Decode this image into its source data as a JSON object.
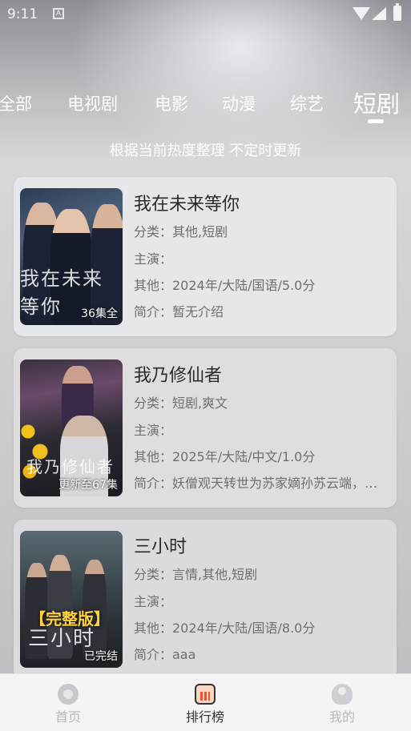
{
  "status": {
    "time": "9:11",
    "notification_icon": "A"
  },
  "tabs": [
    {
      "label": "全部"
    },
    {
      "label": "电视剧"
    },
    {
      "label": "电影"
    },
    {
      "label": "动漫"
    },
    {
      "label": "综艺"
    },
    {
      "label": "短剧",
      "active": true
    }
  ],
  "subtitle": "根据当前热度整理 不定时更新",
  "items": [
    {
      "title": "我在未来等你",
      "category": "分类：其他,短剧",
      "cast": "主演：",
      "other": "其他：2024年/大陆/国语/5.0分",
      "intro": "简介：暂无介绍",
      "badge": "36集全",
      "poster_text": "我在未来等你"
    },
    {
      "title": "我乃修仙者",
      "category": "分类：短剧,爽文",
      "cast": "主演：",
      "other": "其他：2025年/大陆/中文/1.0分",
      "intro": "简介：妖僧观天转世为苏家嫡孙苏云端，在苏家危难之际挺身而出",
      "badge": "更新至67集",
      "poster_text": "我乃修仙者"
    },
    {
      "title": "三小时",
      "category": "分类：言情,其他,短剧",
      "cast": "主演：",
      "other": "其他：2024年/大陆/国语/8.0分",
      "intro": "简介：aaa",
      "badge": "已完结",
      "poster_flag": "【完整版】",
      "poster_text": "三小时"
    }
  ],
  "bottom_nav": [
    {
      "label": "首页",
      "icon": "home-icon"
    },
    {
      "label": "排行榜",
      "icon": "ranking-icon",
      "active": true
    },
    {
      "label": "我的",
      "icon": "profile-icon"
    }
  ],
  "colors": {
    "accent": "#e8552f",
    "tab_text": "#ffffff",
    "card_title": "#2a2a2a",
    "card_meta": "#6e6e72"
  }
}
